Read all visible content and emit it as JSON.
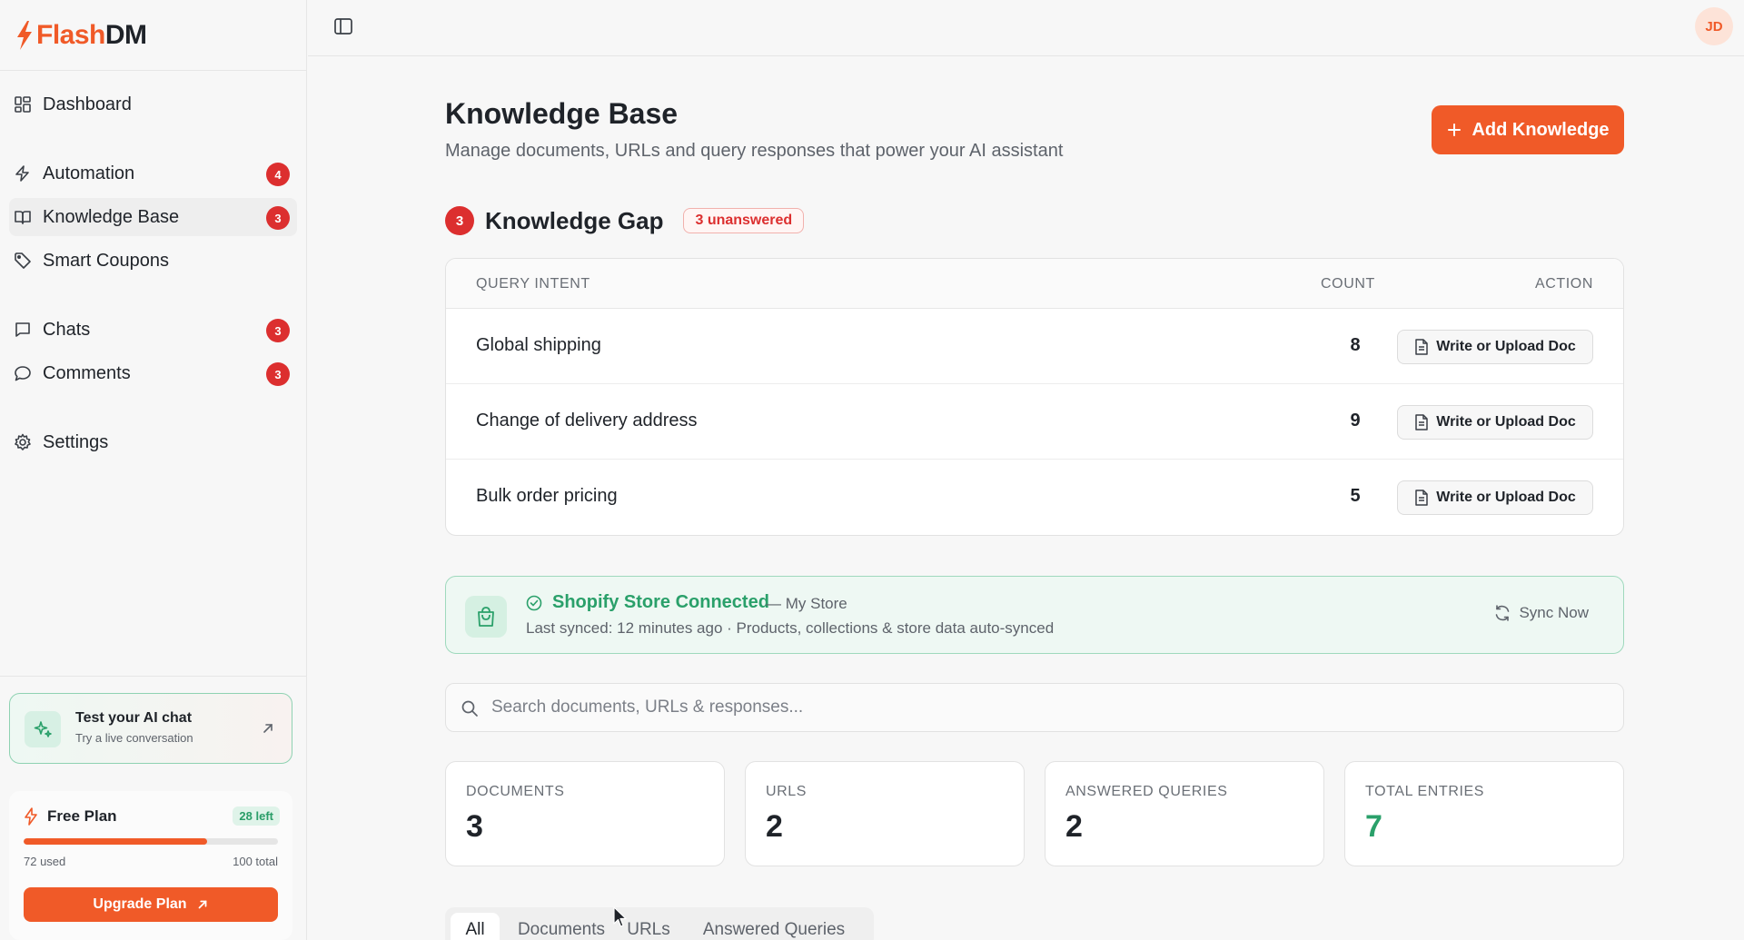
{
  "brand": {
    "name_a": "Flash",
    "name_b": "DM",
    "accent": "#f05a28"
  },
  "nav": {
    "dashboard": {
      "label": "Dashboard",
      "icon": "dashboard-icon"
    },
    "automation": {
      "label": "Automation",
      "badge": "4",
      "icon": "bolt-icon"
    },
    "knowledge": {
      "label": "Knowledge Base",
      "badge": "3",
      "icon": "book-icon"
    },
    "coupons": {
      "label": "Smart Coupons",
      "icon": "tag-icon"
    },
    "chats": {
      "label": "Chats",
      "badge": "3",
      "icon": "chat-icon"
    },
    "comments": {
      "label": "Comments",
      "badge": "3",
      "icon": "comment-icon"
    },
    "settings": {
      "label": "Settings",
      "icon": "gear-icon"
    }
  },
  "test_chat": {
    "title": "Test your AI chat",
    "subtitle": "Try a live conversation"
  },
  "plan": {
    "name": "Free Plan",
    "left": "28 left",
    "used": "72 used",
    "total": "100 total",
    "usage_fraction": 0.72,
    "upgrade_label": "Upgrade Plan"
  },
  "user": {
    "initials": "JD"
  },
  "page": {
    "title": "Knowledge Base",
    "subtitle": "Manage documents, URLs and query responses that power your AI assistant",
    "add_label": "Add Knowledge"
  },
  "gap": {
    "count": "3",
    "title": "Knowledge Gap",
    "unanswered": "3 unanswered",
    "headers": {
      "query": "QUERY INTENT",
      "count": "COUNT",
      "action": "ACTION"
    },
    "rows": [
      {
        "query": "Global shipping",
        "count": "8",
        "action": "Write or Upload Doc"
      },
      {
        "query": "Change of delivery address",
        "count": "9",
        "action": "Write or Upload Doc"
      },
      {
        "query": "Bulk order pricing",
        "count": "5",
        "action": "Write or Upload Doc"
      }
    ]
  },
  "shopify": {
    "status": "Shopify Store Connected",
    "store": "— My Store",
    "sync_info": "Last synced: 12 minutes ago · Products, collections & store data auto-synced",
    "sync_label": "Sync Now"
  },
  "search": {
    "placeholder": "Search documents, URLs & responses..."
  },
  "stats": [
    {
      "label": "DOCUMENTS",
      "value": "3"
    },
    {
      "label": "URLS",
      "value": "2"
    },
    {
      "label": "ANSWERED QUERIES",
      "value": "2"
    },
    {
      "label": "TOTAL ENTRIES",
      "value": "7"
    }
  ],
  "tabs": [
    "All",
    "Documents",
    "URLs",
    "Answered Queries"
  ]
}
